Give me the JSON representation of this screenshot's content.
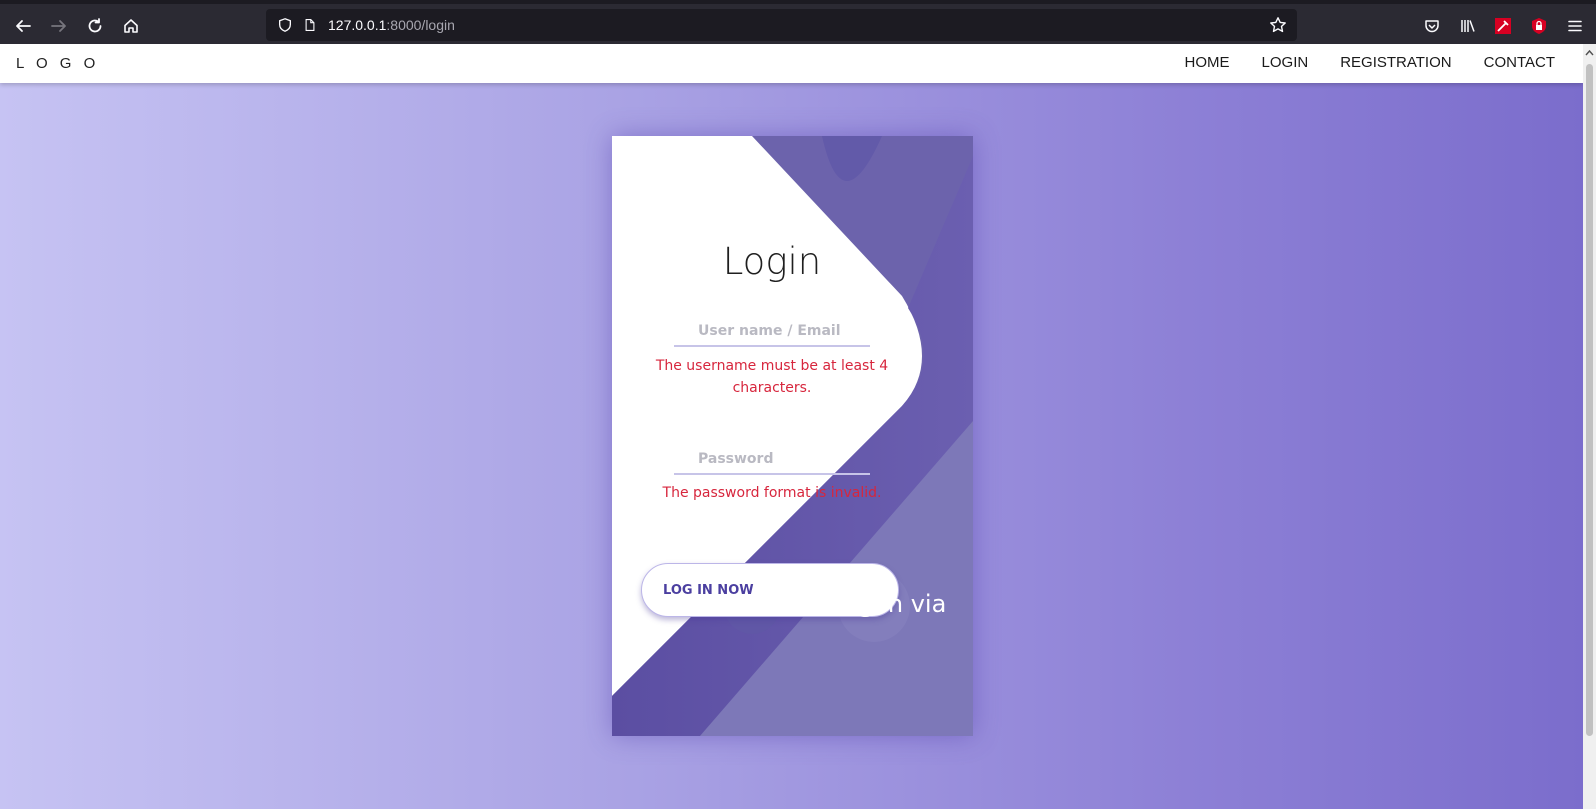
{
  "browser": {
    "url_host": "127.0.0.1",
    "url_path": ":8000/login",
    "icons": [
      "back-arrow-icon",
      "forward-arrow-icon",
      "reload-icon",
      "home-icon",
      "shield-icon",
      "page-icon",
      "star-icon",
      "pocket-icon",
      "library-icon",
      "extension-icon",
      "lock-extension-icon",
      "hamburger-menu-icon"
    ]
  },
  "site": {
    "logo": "L O G O",
    "menu": [
      "HOME",
      "LOGIN",
      "REGISTRATION",
      "CONTACT"
    ]
  },
  "login_card": {
    "title": "Login",
    "username_placeholder": "User name / Email",
    "username_error": "The username must be at least 4 characters.",
    "password_placeholder": "Password",
    "password_error": "The password format is invalid.",
    "login_button": "LOG IN NOW",
    "login_via": "log in via"
  },
  "colors": {
    "accent": "#5c4fa3",
    "background_start": "#c6c3f3",
    "background_end": "#7b6dcc",
    "error": "#d7263d"
  }
}
